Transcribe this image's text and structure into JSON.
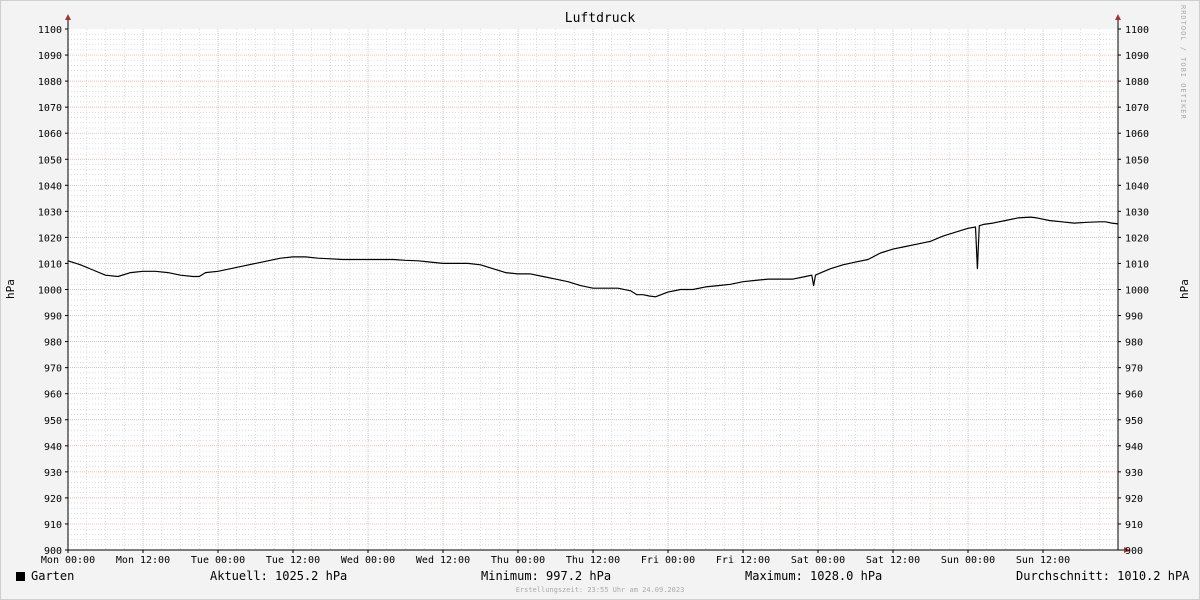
{
  "chart_data": {
    "type": "line",
    "title": "Luftdruck",
    "ylabel": "hPa",
    "ylim": [
      900,
      1100
    ],
    "y_ticks": [
      900,
      910,
      920,
      930,
      940,
      950,
      960,
      970,
      980,
      990,
      1000,
      1010,
      1020,
      1030,
      1040,
      1050,
      1060,
      1070,
      1080,
      1090,
      1100
    ],
    "x_ticks": [
      "Mon 00:00",
      "Mon 12:00",
      "Tue 00:00",
      "Tue 12:00",
      "Wed 00:00",
      "Wed 12:00",
      "Thu 00:00",
      "Thu 12:00",
      "Fri 00:00",
      "Fri 12:00",
      "Sat 00:00",
      "Sat 12:00",
      "Sun 00:00",
      "Sun 12:00"
    ],
    "x_unit": "hours since Mon 00:00",
    "xlim": [
      0,
      168
    ],
    "grid": true,
    "series": [
      {
        "name": "Garten",
        "color": "#000000",
        "points": [
          [
            0,
            1011
          ],
          [
            2,
            1009.5
          ],
          [
            4,
            1007.5
          ],
          [
            6,
            1005.5
          ],
          [
            8,
            1005
          ],
          [
            10,
            1006.5
          ],
          [
            12,
            1007
          ],
          [
            14,
            1007
          ],
          [
            16,
            1006.5
          ],
          [
            18,
            1005.5
          ],
          [
            20,
            1005
          ],
          [
            21,
            1005
          ],
          [
            22,
            1006.5
          ],
          [
            24,
            1007
          ],
          [
            26,
            1008
          ],
          [
            28,
            1009
          ],
          [
            30,
            1010
          ],
          [
            32,
            1011
          ],
          [
            34,
            1012
          ],
          [
            36,
            1012.5
          ],
          [
            38,
            1012.5
          ],
          [
            40,
            1012
          ],
          [
            42,
            1011.8
          ],
          [
            44,
            1011.5
          ],
          [
            46,
            1011.5
          ],
          [
            48,
            1011.5
          ],
          [
            50,
            1011.5
          ],
          [
            52,
            1011.5
          ],
          [
            54,
            1011.2
          ],
          [
            56,
            1011
          ],
          [
            58,
            1010.5
          ],
          [
            60,
            1010
          ],
          [
            62,
            1010
          ],
          [
            64,
            1010
          ],
          [
            66,
            1009.5
          ],
          [
            68,
            1008
          ],
          [
            70,
            1006.5
          ],
          [
            72,
            1006
          ],
          [
            74,
            1006
          ],
          [
            76,
            1005
          ],
          [
            78,
            1004
          ],
          [
            80,
            1003
          ],
          [
            82,
            1001.5
          ],
          [
            84,
            1000.5
          ],
          [
            86,
            1000.5
          ],
          [
            88,
            1000.5
          ],
          [
            90,
            999.5
          ],
          [
            91,
            998
          ],
          [
            92,
            998
          ],
          [
            93,
            997.5
          ],
          [
            94,
            997.2
          ],
          [
            96,
            999
          ],
          [
            98,
            1000
          ],
          [
            100,
            1000
          ],
          [
            102,
            1001
          ],
          [
            104,
            1001.5
          ],
          [
            106,
            1002
          ],
          [
            108,
            1003
          ],
          [
            110,
            1003.5
          ],
          [
            112,
            1004
          ],
          [
            114,
            1004
          ],
          [
            116,
            1004
          ],
          [
            118,
            1005
          ],
          [
            119,
            1005.5
          ],
          [
            119.3,
            1001.5
          ],
          [
            119.6,
            1005.5
          ],
          [
            120,
            1006
          ],
          [
            122,
            1008
          ],
          [
            124,
            1009.5
          ],
          [
            126,
            1010.5
          ],
          [
            128,
            1011.5
          ],
          [
            130,
            1014
          ],
          [
            132,
            1015.5
          ],
          [
            134,
            1016.5
          ],
          [
            136,
            1017.5
          ],
          [
            138,
            1018.5
          ],
          [
            140,
            1020.5
          ],
          [
            142,
            1022
          ],
          [
            144,
            1023.5
          ],
          [
            145.2,
            1024
          ],
          [
            145.5,
            1008
          ],
          [
            145.8,
            1024.5
          ],
          [
            146.5,
            1025
          ],
          [
            148,
            1025.5
          ],
          [
            150,
            1026.5
          ],
          [
            152,
            1027.5
          ],
          [
            154,
            1027.8
          ],
          [
            155,
            1027.5
          ],
          [
            157,
            1026.5
          ],
          [
            159,
            1026
          ],
          [
            161,
            1025.5
          ],
          [
            163,
            1025.8
          ],
          [
            165,
            1026
          ],
          [
            166,
            1026
          ],
          [
            167,
            1025.5
          ],
          [
            168,
            1025.2
          ]
        ]
      }
    ]
  },
  "legend": {
    "series_name": "Garten",
    "current": "Aktuell: 1025.2 hPa",
    "minimum": "Minimum: 997.2 hPa",
    "maximum": "Maximum: 1028.0 hPa",
    "average": "Durchschnitt: 1010.2 hPA"
  },
  "watermark": "RRDTOOL / TOBI OETIKER",
  "footer": "Erstellungszeit: 23:55 Uhr am 24.09.2023",
  "colors": {
    "major_grid": "#f0a0a0",
    "minor_grid": "#c8c8c8",
    "axis": "#000000",
    "arrow": "#b03030",
    "line": "#000000"
  }
}
